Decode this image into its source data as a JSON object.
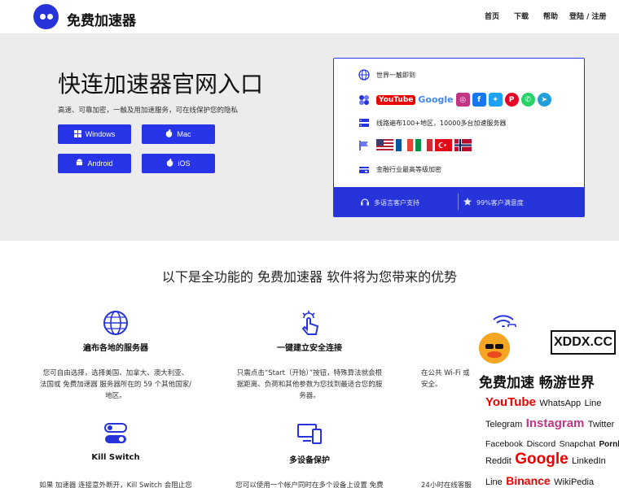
{
  "header": {
    "brand": "免费加速器",
    "nav": [
      "首页",
      "下载",
      "帮助",
      "登陆 / 注册"
    ]
  },
  "hero": {
    "title": "快连加速器官网入口",
    "subtitle": "高速、可靠加密，一触及用加速服务，可在线保护您的隐私",
    "buttons": [
      "Windows",
      "Mac",
      "Android",
      "iOS"
    ]
  },
  "card": {
    "row1": "世界一触即到",
    "brands": [
      "YouTube",
      "Google"
    ],
    "row3": "线路遍布100+地区，10000多台加速服务器",
    "row5": "金融行业最高等级加密",
    "footer_left": "多语言客户支持",
    "footer_right": "99%客户满意度"
  },
  "features": {
    "title": "以下是全功能的 免费加速器 软件将为您带来的优势",
    "items": [
      {
        "title": "遍布各地的服务器",
        "desc1": "您可自由选择，选择美国、加拿大、澳大利亚、",
        "desc2": "法国或 免费加速器 服务器所在的 59 个其他国家/",
        "desc3": "地区。"
      },
      {
        "title": "一键建立安全连接",
        "desc1": "只需点击“Start（开始）”按钮，特殊算法就会根",
        "desc2": "据距离、负荷和其他参数为您找到最适合您的服",
        "desc3": "务器。"
      },
      {
        "title": "",
        "desc1": "在公共 Wi-Fi 或",
        "desc2": "安全。",
        "desc3": ""
      },
      {
        "title": "Kill Switch",
        "desc1": "如果 加速器 连接意外断开，Kill Switch 会阻止您",
        "desc2": "",
        "desc3": ""
      },
      {
        "title": "多设备保护",
        "desc1": "您可以使用一个帐户同时在多个设备上设置 免费",
        "desc2": "",
        "desc3": ""
      },
      {
        "title": "",
        "desc1": "24小时在线客服",
        "desc2": "",
        "desc3": ""
      }
    ]
  },
  "ad": {
    "site": "XDDX.CC",
    "slogan": "免费加速 畅游世界",
    "l1a": "YouTube",
    "l1b": "WhatsApp",
    "l1c": "Line",
    "l2a": "Telegram",
    "l2b": "Instagram",
    "l2c": "Twitter",
    "l3a": "Facebook",
    "l3b": "Discord",
    "l3c": "Snapchat",
    "l3d": "Pornhub",
    "l4a": "Reddit",
    "l4b": "Google",
    "l4c": "LinkedIn",
    "l5a": "Line",
    "l5b": "Binance",
    "l5c": "WikiPedia"
  },
  "colors": {
    "accent": "#2734e8",
    "hero_bg": "#ececec",
    "card_footer": "#2734d9"
  }
}
